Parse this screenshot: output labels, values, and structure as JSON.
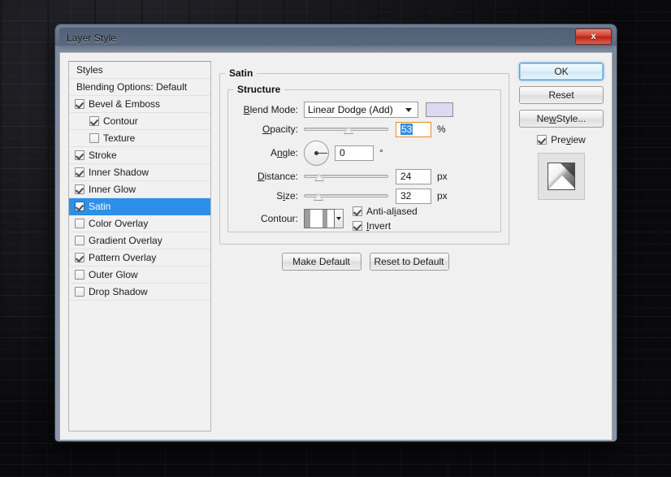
{
  "window": {
    "title": "Layer Style",
    "close_label": "x"
  },
  "styles_panel": {
    "header": "Styles",
    "blending_options": "Blending Options: Default",
    "items": [
      {
        "label": "Bevel & Emboss",
        "checked": true,
        "indent": false,
        "selected": false
      },
      {
        "label": "Contour",
        "checked": true,
        "indent": true,
        "selected": false
      },
      {
        "label": "Texture",
        "checked": false,
        "indent": true,
        "selected": false
      },
      {
        "label": "Stroke",
        "checked": true,
        "indent": false,
        "selected": false
      },
      {
        "label": "Inner Shadow",
        "checked": true,
        "indent": false,
        "selected": false
      },
      {
        "label": "Inner Glow",
        "checked": true,
        "indent": false,
        "selected": false
      },
      {
        "label": "Satin",
        "checked": true,
        "indent": false,
        "selected": true
      },
      {
        "label": "Color Overlay",
        "checked": false,
        "indent": false,
        "selected": false
      },
      {
        "label": "Gradient Overlay",
        "checked": false,
        "indent": false,
        "selected": false
      },
      {
        "label": "Pattern Overlay",
        "checked": true,
        "indent": false,
        "selected": false
      },
      {
        "label": "Outer Glow",
        "checked": false,
        "indent": false,
        "selected": false
      },
      {
        "label": "Drop Shadow",
        "checked": false,
        "indent": false,
        "selected": false
      }
    ]
  },
  "satin": {
    "group_title": "Satin",
    "structure_title": "Structure",
    "blend_mode": {
      "label": "Blend Mode:",
      "value": "Linear Dodge (Add)",
      "color_swatch": "#ded8f2"
    },
    "opacity": {
      "label": "Opacity:",
      "value": "53",
      "unit": "%",
      "slider_percent": 53
    },
    "angle": {
      "label": "Angle:",
      "value": "0",
      "unit": "°",
      "degrees": 0
    },
    "distance": {
      "label": "Distance:",
      "value": "24",
      "unit": "px",
      "slider_percent": 18
    },
    "size": {
      "label": "Size:",
      "value": "32",
      "unit": "px",
      "slider_percent": 17
    },
    "contour": {
      "label": "Contour:",
      "anti_aliased_label": "Anti-aliased",
      "anti_aliased_checked": true,
      "invert_label": "Invert",
      "invert_checked": true
    },
    "make_default_label": "Make Default",
    "reset_to_default_label": "Reset to Default"
  },
  "side_panel": {
    "ok_label": "OK",
    "reset_label": "Reset",
    "new_style_label": "New Style...",
    "preview_label": "Preview",
    "preview_checked": true
  },
  "colors": {
    "selection_blue": "#2c8fe8",
    "dialog_face": "#f0f0f0",
    "close_red": "#cf3c2c"
  }
}
